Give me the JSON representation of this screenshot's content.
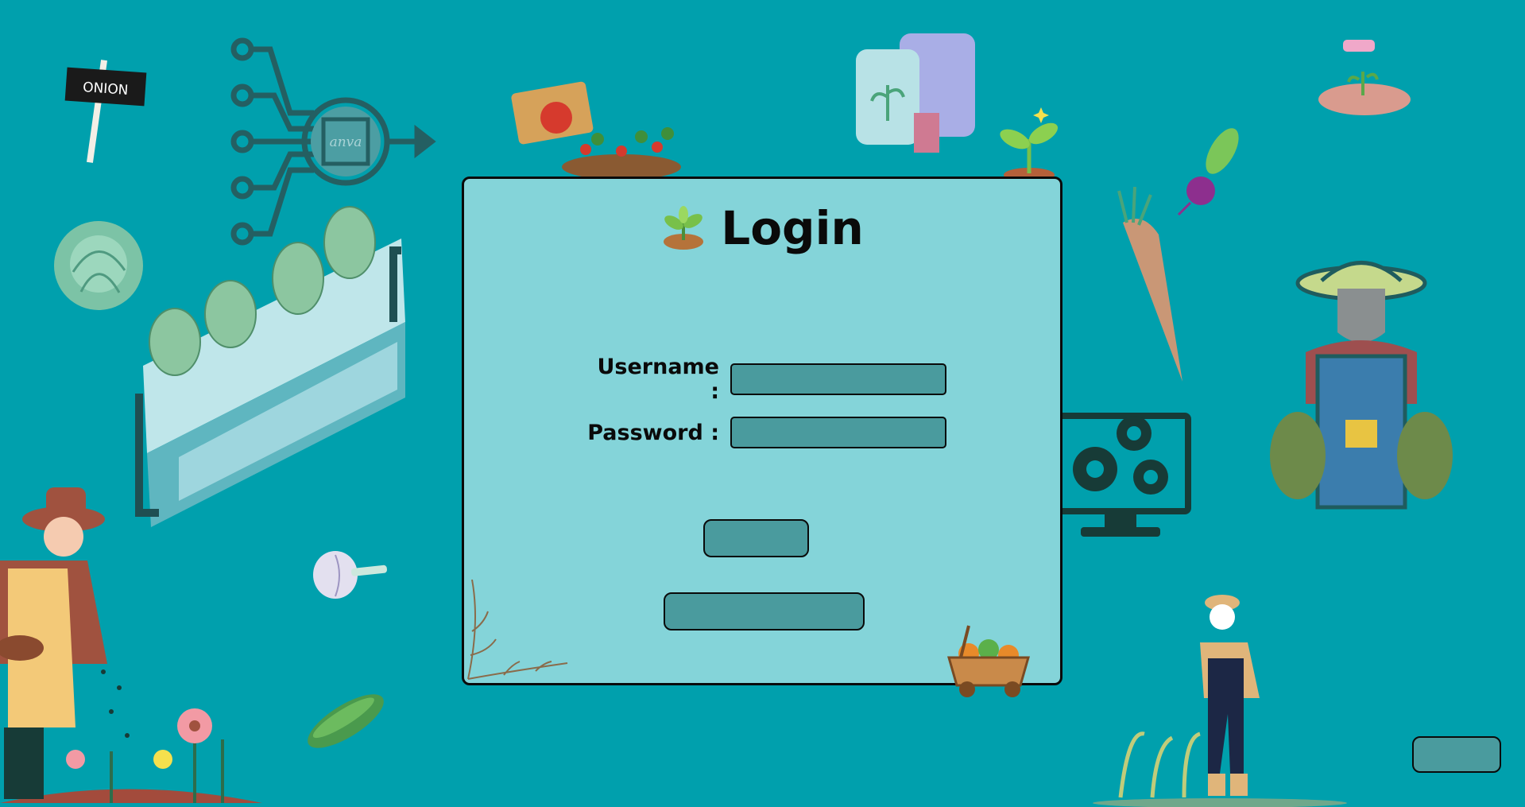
{
  "login": {
    "title": "Login",
    "username_label": "Username :",
    "username_value": "",
    "password_label": "Password :",
    "password_value": "",
    "submit_label": "",
    "secondary_label": ""
  },
  "corner_button_label": "",
  "decor": {
    "onion_sign_text": "ONION",
    "chip_text": "anva"
  },
  "colors": {
    "background": "#00a0ad",
    "panel": "#84d4d9",
    "field": "#4a9b9e",
    "border": "#0a0a0a"
  }
}
